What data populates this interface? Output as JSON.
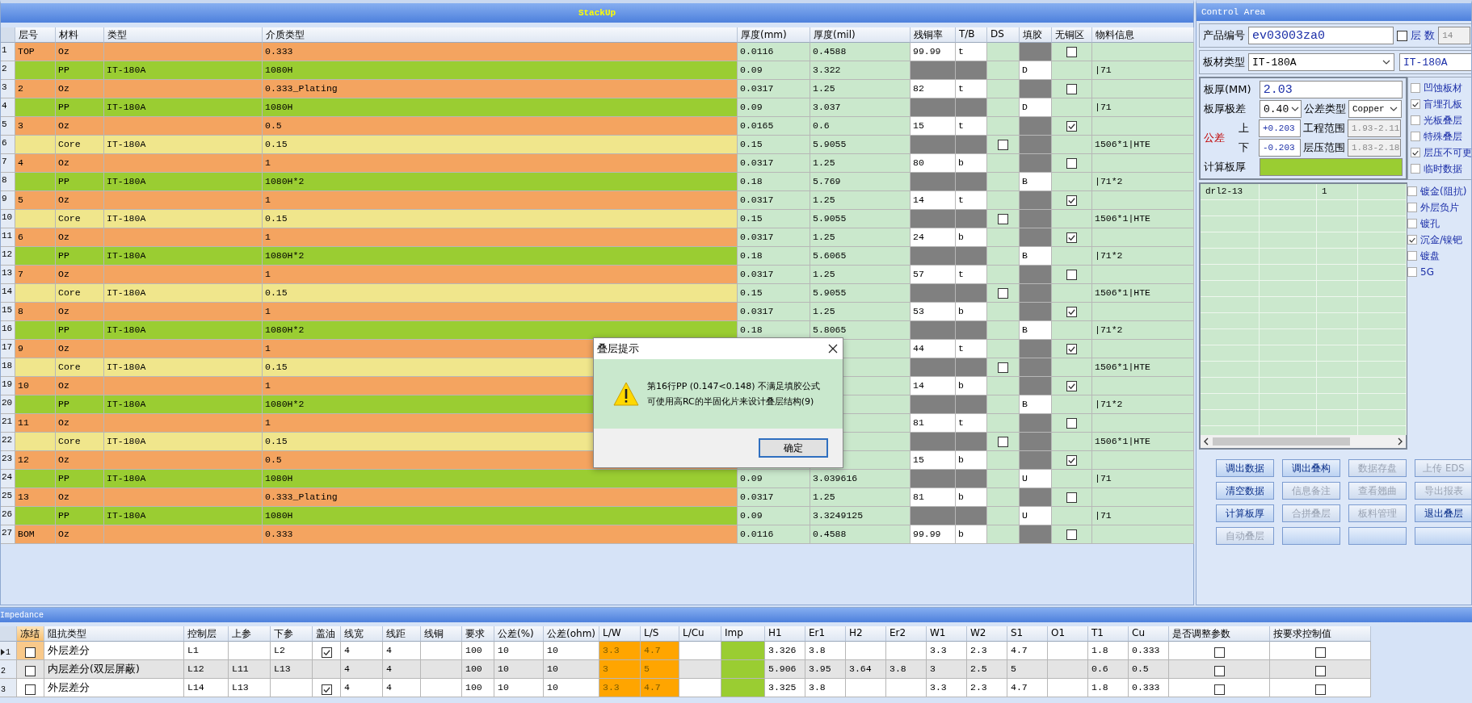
{
  "stackup": {
    "title": "StackUp",
    "columns": [
      "层号",
      "材料",
      "类型",
      "介质类型",
      "厚度(mm)",
      "厚度(mil)",
      "残铜率",
      "T/B",
      "DS",
      "填胶",
      "无铜区",
      "物料信息"
    ],
    "rows": [
      {
        "num": "1",
        "kind": "copper",
        "layer": "TOP",
        "material": "Oz",
        "dielectric": "0.333",
        "mm": "0.0116",
        "mil": "0.4588",
        "copper": "99.99",
        "tb": "t",
        "no_copper": false
      },
      {
        "num": "2",
        "kind": "pp",
        "material": "PP",
        "type": "IT-180A",
        "dielectric": "1080H",
        "mm": "0.09",
        "mil": "3.322",
        "fill": "D",
        "info": "|71"
      },
      {
        "num": "3",
        "kind": "copper",
        "layer": "2",
        "material": "Oz",
        "dielectric": "0.333_Plating",
        "mm": "0.0317",
        "mil": "1.25",
        "copper": "82",
        "tb": "t",
        "no_copper": false
      },
      {
        "num": "4",
        "kind": "pp",
        "material": "PP",
        "type": "IT-180A",
        "dielectric": "1080H",
        "mm": "0.09",
        "mil": "3.037",
        "fill": "D",
        "info": "|71"
      },
      {
        "num": "5",
        "kind": "copper",
        "layer": "3",
        "material": "Oz",
        "dielectric": "0.5",
        "mm": "0.0165",
        "mil": "0.6",
        "copper": "15",
        "tb": "t",
        "no_copper": true
      },
      {
        "num": "6",
        "kind": "core",
        "material": "Core",
        "type": "IT-180A",
        "dielectric": "0.15",
        "mm": "0.15",
        "mil": "5.9055",
        "ds": false,
        "info": "1506*1|HTE"
      },
      {
        "num": "7",
        "kind": "copper",
        "layer": "4",
        "material": "Oz",
        "dielectric": "1",
        "mm": "0.0317",
        "mil": "1.25",
        "copper": "80",
        "tb": "b",
        "no_copper": false
      },
      {
        "num": "8",
        "kind": "pp",
        "material": "PP",
        "type": "IT-180A",
        "dielectric": "1080H*2",
        "mm": "0.18",
        "mil": "5.769",
        "fill": "B",
        "info": "|71*2"
      },
      {
        "num": "9",
        "kind": "copper",
        "layer": "5",
        "material": "Oz",
        "dielectric": "1",
        "mm": "0.0317",
        "mil": "1.25",
        "copper": "14",
        "tb": "t",
        "no_copper": true
      },
      {
        "num": "10",
        "kind": "core",
        "material": "Core",
        "type": "IT-180A",
        "dielectric": "0.15",
        "mm": "0.15",
        "mil": "5.9055",
        "ds": false,
        "info": "1506*1|HTE"
      },
      {
        "num": "11",
        "kind": "copper",
        "layer": "6",
        "material": "Oz",
        "dielectric": "1",
        "mm": "0.0317",
        "mil": "1.25",
        "copper": "24",
        "tb": "b",
        "no_copper": true
      },
      {
        "num": "12",
        "kind": "pp",
        "material": "PP",
        "type": "IT-180A",
        "dielectric": "1080H*2",
        "mm": "0.18",
        "mil": "5.6065",
        "fill": "B",
        "info": "|71*2"
      },
      {
        "num": "13",
        "kind": "copper",
        "layer": "7",
        "material": "Oz",
        "dielectric": "1",
        "mm": "0.0317",
        "mil": "1.25",
        "copper": "57",
        "tb": "t",
        "no_copper": false
      },
      {
        "num": "14",
        "kind": "core",
        "material": "Core",
        "type": "IT-180A",
        "dielectric": "0.15",
        "mm": "0.15",
        "mil": "5.9055",
        "ds": false,
        "info": "1506*1|HTE"
      },
      {
        "num": "15",
        "kind": "copper",
        "layer": "8",
        "material": "Oz",
        "dielectric": "1",
        "mm": "0.0317",
        "mil": "1.25",
        "copper": "53",
        "tb": "b",
        "no_copper": true
      },
      {
        "num": "16",
        "kind": "pp",
        "material": "PP",
        "type": "IT-180A",
        "dielectric": "1080H*2",
        "mm": "0.18",
        "mil": "5.8065",
        "fill": "B",
        "info": "|71*2"
      },
      {
        "num": "17",
        "kind": "copper",
        "layer": "9",
        "material": "Oz",
        "dielectric": "1",
        "copper": "44",
        "tb": "t",
        "no_copper": true
      },
      {
        "num": "18",
        "kind": "core",
        "material": "Core",
        "type": "IT-180A",
        "dielectric": "0.15",
        "ds": false,
        "info": "1506*1|HTE"
      },
      {
        "num": "19",
        "kind": "copper",
        "layer": "10",
        "material": "Oz",
        "dielectric": "1",
        "copper": "14",
        "tb": "b",
        "no_copper": true
      },
      {
        "num": "20",
        "kind": "pp",
        "material": "PP",
        "type": "IT-180A",
        "dielectric": "1080H*2",
        "fill": "B",
        "info": "|71*2"
      },
      {
        "num": "21",
        "kind": "copper",
        "layer": "11",
        "material": "Oz",
        "dielectric": "1",
        "copper": "81",
        "tb": "t",
        "no_copper": false
      },
      {
        "num": "22",
        "kind": "core",
        "material": "Core",
        "type": "IT-180A",
        "dielectric": "0.15",
        "ds": false,
        "info": "1506*1|HTE"
      },
      {
        "num": "23",
        "kind": "copper",
        "layer": "12",
        "material": "Oz",
        "dielectric": "0.5",
        "copper": "15",
        "tb": "b",
        "no_copper": true
      },
      {
        "num": "24",
        "kind": "pp",
        "material": "PP",
        "type": "IT-180A",
        "dielectric": "1080H",
        "mm": "0.09",
        "mil": "3.039616",
        "fill": "U",
        "info": "|71"
      },
      {
        "num": "25",
        "kind": "copper",
        "layer": "13",
        "material": "Oz",
        "dielectric": "0.333_Plating",
        "mm": "0.0317",
        "mil": "1.25",
        "copper": "81",
        "tb": "b",
        "no_copper": false
      },
      {
        "num": "26",
        "kind": "pp",
        "material": "PP",
        "type": "IT-180A",
        "dielectric": "1080H",
        "mm": "0.09",
        "mil": "3.3249125",
        "fill": "U",
        "info": "|71"
      },
      {
        "num": "27",
        "kind": "copper",
        "layer": "BOM",
        "material": "Oz",
        "dielectric": "0.333",
        "mm": "0.0116",
        "mil": "0.4588",
        "copper": "99.99",
        "tb": "b",
        "no_copper": false
      }
    ]
  },
  "control_area": {
    "title": "Control Area",
    "product_label": "产品编号",
    "product_value": "ev03003za0",
    "layers_checkbox": false,
    "layers_label": "层 数",
    "layers_value": "14",
    "board_label": "板材类型",
    "board_value": "IT-180A",
    "board_value_2": "IT-180A",
    "thickness_label": "板厚(MM)",
    "thickness_value": "2.03",
    "range_label": "板厚极差",
    "range_value": "0.40",
    "tol_type_label": "公差类型",
    "tol_type_value": "Copper",
    "tol_label": "公差",
    "upper_label": "上",
    "upper_value": "+0.203",
    "lower_label": "下",
    "lower_value": "-0.203",
    "eng_label": "工程范围",
    "eng_value": "1.93-2.11",
    "press_label": "层压范围",
    "press_value": "1.83-2.18",
    "calc_label": "计算板厚",
    "options": [
      {
        "label": "凹蚀板材",
        "checked": false
      },
      {
        "label": "盲埋孔板",
        "checked": true
      },
      {
        "label": "光板叠层",
        "checked": false
      },
      {
        "label": "特殊叠层",
        "checked": false
      },
      {
        "label": "层压不可更",
        "checked": true
      },
      {
        "label": "临时数据",
        "checked": false
      }
    ],
    "options_2": [
      {
        "label": "镀金(阻抗)",
        "checked": false
      },
      {
        "label": "外层负片",
        "checked": false
      },
      {
        "label": "镀孔",
        "checked": false
      },
      {
        "label": "沉金/镍钯",
        "checked": true
      },
      {
        "label": "镀盘",
        "checked": false
      },
      {
        "label": "5G",
        "checked": false
      }
    ],
    "drill_rows": [
      [
        "drl2-13",
        null,
        "1",
        null
      ]
    ],
    "buttons": [
      {
        "label": "调出数据",
        "disabled": false
      },
      {
        "label": "调出叠构",
        "disabled": false
      },
      {
        "label": "数据存盘",
        "disabled": true
      },
      {
        "label": "上传 EDS",
        "disabled": true
      },
      {
        "label": "清空数据",
        "disabled": false
      },
      {
        "label": "信息备注",
        "disabled": true
      },
      {
        "label": "查看翘曲",
        "disabled": true
      },
      {
        "label": "导出报表",
        "disabled": true
      },
      {
        "label": "计算板厚",
        "disabled": false
      },
      {
        "label": "合拼叠层",
        "disabled": true
      },
      {
        "label": "板料管理",
        "disabled": true
      },
      {
        "label": "退出叠层",
        "disabled": false
      },
      {
        "label": "自动叠层",
        "disabled": true
      },
      {
        "disabled": false
      },
      {
        "disabled": false
      },
      {
        "disabled": false
      }
    ]
  },
  "impedance": {
    "title": "Impedance",
    "columns": [
      {
        "label": "冻结",
        "kind": "check",
        "current": true
      },
      {
        "label": "阻抗类型",
        "kind": "text"
      },
      {
        "label": "控制层",
        "kind": "text"
      },
      {
        "label": "上参",
        "kind": "text"
      },
      {
        "label": "下参",
        "kind": "text"
      },
      {
        "label": "盖油",
        "kind": "check"
      },
      {
        "label": "线宽",
        "kind": "text"
      },
      {
        "label": "线距",
        "kind": "text"
      },
      {
        "label": "线铜",
        "kind": "text"
      },
      {
        "label": "要求",
        "kind": "text"
      },
      {
        "label": "公差(%)",
        "kind": "text"
      },
      {
        "label": "公差(ohm)",
        "kind": "text"
      },
      {
        "label": "L/W",
        "kind": "orange"
      },
      {
        "label": "L/S",
        "kind": "orange"
      },
      {
        "label": "L/Cu",
        "kind": "text"
      },
      {
        "label": "Imp",
        "kind": "imp"
      },
      {
        "label": "H1",
        "kind": "text"
      },
      {
        "label": "Er1",
        "kind": "text"
      },
      {
        "label": "H2",
        "kind": "text"
      },
      {
        "label": "Er2",
        "kind": "text"
      },
      {
        "label": "W1",
        "kind": "text"
      },
      {
        "label": "W2",
        "kind": "text"
      },
      {
        "label": "S1",
        "kind": "text"
      },
      {
        "label": "O1",
        "kind": "text"
      },
      {
        "label": "T1",
        "kind": "text"
      },
      {
        "label": "Cu",
        "kind": "text"
      },
      {
        "label": "是否调整参数",
        "kind": "check"
      },
      {
        "label": "按要求控制值",
        "kind": "check"
      }
    ],
    "rows": [
      {
        "num": "1",
        "selected": true,
        "cells": [
          false,
          "外层差分",
          "L1",
          null,
          "L2",
          true,
          "4",
          "4",
          null,
          "100",
          "10",
          "10",
          "3.3",
          "4.7",
          null,
          null,
          "3.326",
          "3.8",
          null,
          null,
          "3.3",
          "2.3",
          "4.7",
          null,
          "1.8",
          "0.333",
          false,
          false
        ]
      },
      {
        "num": "2",
        "selected": false,
        "cells": [
          false,
          "内层差分(双层屏蔽)",
          "L12",
          "L11",
          "L13",
          null,
          "4",
          "4",
          null,
          "100",
          "10",
          "10",
          "3",
          "5",
          null,
          null,
          "5.906",
          "3.95",
          "3.64",
          "3.8",
          "3",
          "2.5",
          "5",
          null,
          "0.6",
          "0.5",
          false,
          false
        ]
      },
      {
        "num": "3",
        "selected": false,
        "cells": [
          false,
          "外层差分",
          "L14",
          "L13",
          null,
          true,
          "4",
          "4",
          null,
          "100",
          "10",
          "10",
          "3.3",
          "4.7",
          null,
          null,
          "3.325",
          "3.8",
          null,
          null,
          "3.3",
          "2.3",
          "4.7",
          null,
          "1.8",
          "0.333",
          false,
          false
        ]
      }
    ]
  },
  "dialog": {
    "title": "叠层提示",
    "message_1": "第16行PP (0.147<0.148) 不满足填胶公式",
    "message_2": "可使用高RC的半固化片来设计叠层结构(9)",
    "button": "确定"
  }
}
